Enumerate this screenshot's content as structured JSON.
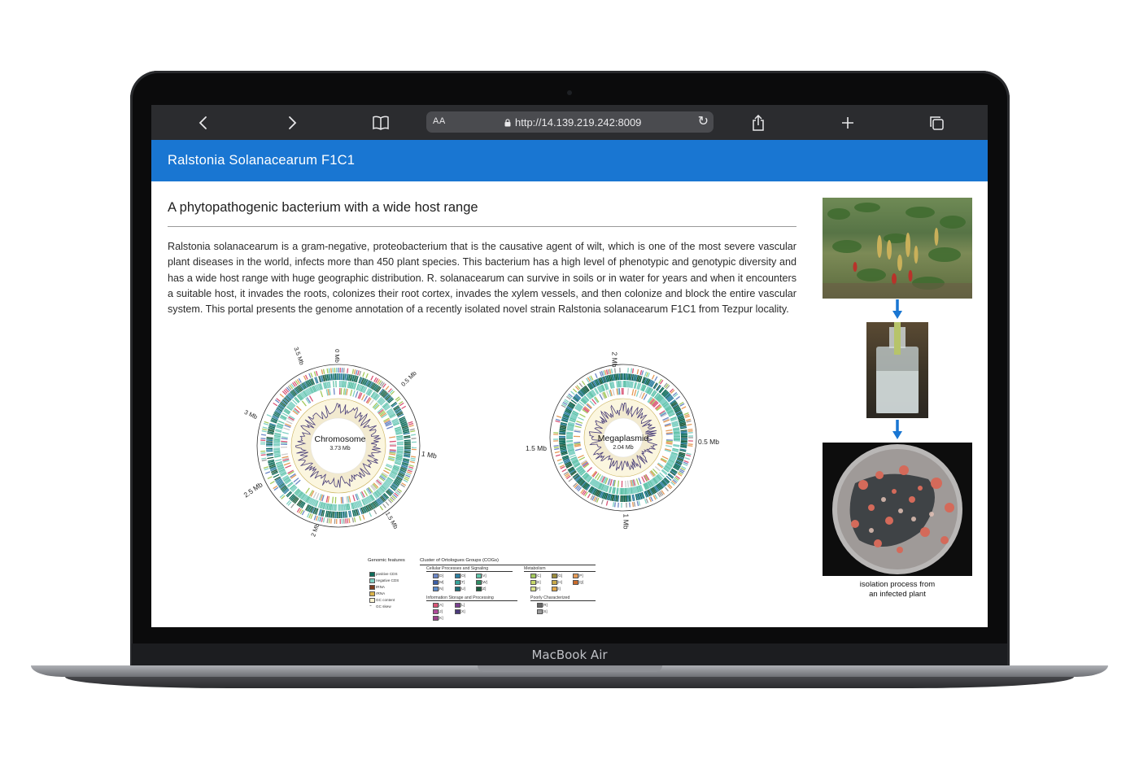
{
  "device": {
    "brand": "MacBook Air"
  },
  "browser": {
    "aa_label": "AA",
    "url": "http://14.139.219.242:8009"
  },
  "app": {
    "title": "Ralstonia Solanacearum F1C1"
  },
  "main": {
    "heading": "A phytopathogenic bacterium with a wide host range",
    "paragraph": "Ralstonia solanacearum is a gram-negative, proteobacterium that is the causative agent of wilt, which is one of the most severe vascular plant diseases in the world, infects more than 450 plant species. This bacterium has a high level of phenotypic and genotypic diversity and has a wide host range with huge geographic distribution. R. solanacearum can survive in soils or in water for years and when it encounters a suitable host, it invades the roots, colonizes their root cortex, invades the xylem vessels, and then colonize and block the entire vascular system. This portal presents the genome annotation of a recently isolated novel strain Ralstonia solanacearum F1C1 from Tezpur locality."
  },
  "chromosome_map": {
    "name": "Chromosome",
    "size": "3.73 Mb",
    "ticks": [
      "0 Mb",
      "0.5 Mb",
      "1 Mb",
      "1.5 Mb",
      "2 Mb",
      "2.5 Mb",
      "3 Mb",
      "3.5 Mb"
    ]
  },
  "megaplasmid_map": {
    "name": "Megaplasmid",
    "size": "2.04 Mb",
    "ticks": [
      "2 Mb",
      "0.5 Mb",
      "1 Mb",
      "1.5 Mb"
    ]
  },
  "legend": {
    "genomic_title": "Genomic features",
    "genomic_items": [
      "positive CDS",
      "negative CDS",
      "tRNA",
      "rRNA",
      "GC content",
      "GC skew"
    ],
    "cog_title": "Cluster of Ortologues Groups (COGs)",
    "cellular_title": "Cellular Processes and Signaling",
    "cellular_codes": [
      "[D]",
      "[M]",
      "[N]",
      "[O]",
      "[T]",
      "[U]",
      "[V]",
      "[W]",
      "[Z]"
    ],
    "metabolism_title": "Metabolism",
    "metabolism_codes": [
      "[C]",
      "[E]",
      "[F]",
      "[G]",
      "[H]",
      "[I]",
      "[P]",
      "[Q]"
    ],
    "info_title": "Information Storage and Processing",
    "info_codes": [
      "[A]",
      "[J]",
      "[K]",
      "[L]",
      "[X]"
    ],
    "poor_title": "Poorly Characterized",
    "poor_codes": [
      "[R]",
      "[S]"
    ]
  },
  "side_panel": {
    "caption_line1": "isolation process from",
    "caption_line2": "an infected plant"
  },
  "colors": {
    "appbar": "#1976d2",
    "toolbar": "#2b2c2f",
    "positive_cds": "#0e6b5a",
    "negative_cds": "#7fd0c3"
  }
}
